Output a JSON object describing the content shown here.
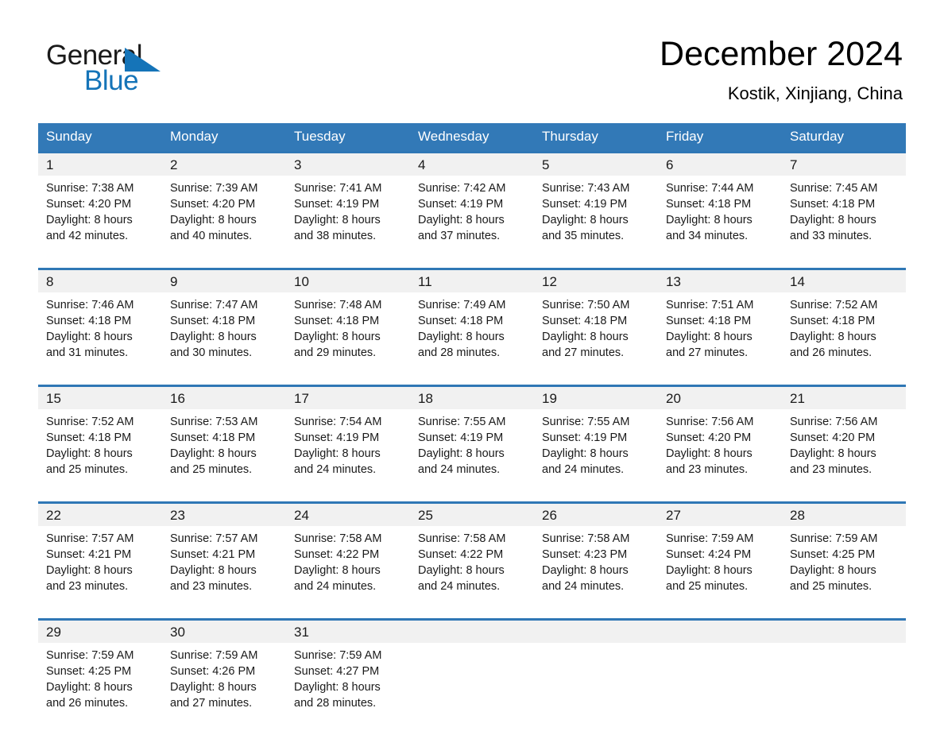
{
  "brand": {
    "name_part1": "General",
    "name_part2": "Blue",
    "accent_color": "#1574b8"
  },
  "header": {
    "title": "December 2024",
    "subtitle": "Kostik, Xinjiang, China"
  },
  "theme": {
    "header_row_bg": "#3279b7",
    "daynum_bg": "#f1f1f1",
    "separator": "#2f77b5"
  },
  "weekday_headers": [
    "Sunday",
    "Monday",
    "Tuesday",
    "Wednesday",
    "Thursday",
    "Friday",
    "Saturday"
  ],
  "weeks": [
    {
      "days": [
        {
          "date": "1",
          "sunrise": "Sunrise: 7:38 AM",
          "sunset": "Sunset: 4:20 PM",
          "daylight_1": "Daylight: 8 hours",
          "daylight_2": "and 42 minutes."
        },
        {
          "date": "2",
          "sunrise": "Sunrise: 7:39 AM",
          "sunset": "Sunset: 4:20 PM",
          "daylight_1": "Daylight: 8 hours",
          "daylight_2": "and 40 minutes."
        },
        {
          "date": "3",
          "sunrise": "Sunrise: 7:41 AM",
          "sunset": "Sunset: 4:19 PM",
          "daylight_1": "Daylight: 8 hours",
          "daylight_2": "and 38 minutes."
        },
        {
          "date": "4",
          "sunrise": "Sunrise: 7:42 AM",
          "sunset": "Sunset: 4:19 PM",
          "daylight_1": "Daylight: 8 hours",
          "daylight_2": "and 37 minutes."
        },
        {
          "date": "5",
          "sunrise": "Sunrise: 7:43 AM",
          "sunset": "Sunset: 4:19 PM",
          "daylight_1": "Daylight: 8 hours",
          "daylight_2": "and 35 minutes."
        },
        {
          "date": "6",
          "sunrise": "Sunrise: 7:44 AM",
          "sunset": "Sunset: 4:18 PM",
          "daylight_1": "Daylight: 8 hours",
          "daylight_2": "and 34 minutes."
        },
        {
          "date": "7",
          "sunrise": "Sunrise: 7:45 AM",
          "sunset": "Sunset: 4:18 PM",
          "daylight_1": "Daylight: 8 hours",
          "daylight_2": "and 33 minutes."
        }
      ]
    },
    {
      "days": [
        {
          "date": "8",
          "sunrise": "Sunrise: 7:46 AM",
          "sunset": "Sunset: 4:18 PM",
          "daylight_1": "Daylight: 8 hours",
          "daylight_2": "and 31 minutes."
        },
        {
          "date": "9",
          "sunrise": "Sunrise: 7:47 AM",
          "sunset": "Sunset: 4:18 PM",
          "daylight_1": "Daylight: 8 hours",
          "daylight_2": "and 30 minutes."
        },
        {
          "date": "10",
          "sunrise": "Sunrise: 7:48 AM",
          "sunset": "Sunset: 4:18 PM",
          "daylight_1": "Daylight: 8 hours",
          "daylight_2": "and 29 minutes."
        },
        {
          "date": "11",
          "sunrise": "Sunrise: 7:49 AM",
          "sunset": "Sunset: 4:18 PM",
          "daylight_1": "Daylight: 8 hours",
          "daylight_2": "and 28 minutes."
        },
        {
          "date": "12",
          "sunrise": "Sunrise: 7:50 AM",
          "sunset": "Sunset: 4:18 PM",
          "daylight_1": "Daylight: 8 hours",
          "daylight_2": "and 27 minutes."
        },
        {
          "date": "13",
          "sunrise": "Sunrise: 7:51 AM",
          "sunset": "Sunset: 4:18 PM",
          "daylight_1": "Daylight: 8 hours",
          "daylight_2": "and 27 minutes."
        },
        {
          "date": "14",
          "sunrise": "Sunrise: 7:52 AM",
          "sunset": "Sunset: 4:18 PM",
          "daylight_1": "Daylight: 8 hours",
          "daylight_2": "and 26 minutes."
        }
      ]
    },
    {
      "days": [
        {
          "date": "15",
          "sunrise": "Sunrise: 7:52 AM",
          "sunset": "Sunset: 4:18 PM",
          "daylight_1": "Daylight: 8 hours",
          "daylight_2": "and 25 minutes."
        },
        {
          "date": "16",
          "sunrise": "Sunrise: 7:53 AM",
          "sunset": "Sunset: 4:18 PM",
          "daylight_1": "Daylight: 8 hours",
          "daylight_2": "and 25 minutes."
        },
        {
          "date": "17",
          "sunrise": "Sunrise: 7:54 AM",
          "sunset": "Sunset: 4:19 PM",
          "daylight_1": "Daylight: 8 hours",
          "daylight_2": "and 24 minutes."
        },
        {
          "date": "18",
          "sunrise": "Sunrise: 7:55 AM",
          "sunset": "Sunset: 4:19 PM",
          "daylight_1": "Daylight: 8 hours",
          "daylight_2": "and 24 minutes."
        },
        {
          "date": "19",
          "sunrise": "Sunrise: 7:55 AM",
          "sunset": "Sunset: 4:19 PM",
          "daylight_1": "Daylight: 8 hours",
          "daylight_2": "and 24 minutes."
        },
        {
          "date": "20",
          "sunrise": "Sunrise: 7:56 AM",
          "sunset": "Sunset: 4:20 PM",
          "daylight_1": "Daylight: 8 hours",
          "daylight_2": "and 23 minutes."
        },
        {
          "date": "21",
          "sunrise": "Sunrise: 7:56 AM",
          "sunset": "Sunset: 4:20 PM",
          "daylight_1": "Daylight: 8 hours",
          "daylight_2": "and 23 minutes."
        }
      ]
    },
    {
      "days": [
        {
          "date": "22",
          "sunrise": "Sunrise: 7:57 AM",
          "sunset": "Sunset: 4:21 PM",
          "daylight_1": "Daylight: 8 hours",
          "daylight_2": "and 23 minutes."
        },
        {
          "date": "23",
          "sunrise": "Sunrise: 7:57 AM",
          "sunset": "Sunset: 4:21 PM",
          "daylight_1": "Daylight: 8 hours",
          "daylight_2": "and 23 minutes."
        },
        {
          "date": "24",
          "sunrise": "Sunrise: 7:58 AM",
          "sunset": "Sunset: 4:22 PM",
          "daylight_1": "Daylight: 8 hours",
          "daylight_2": "and 24 minutes."
        },
        {
          "date": "25",
          "sunrise": "Sunrise: 7:58 AM",
          "sunset": "Sunset: 4:22 PM",
          "daylight_1": "Daylight: 8 hours",
          "daylight_2": "and 24 minutes."
        },
        {
          "date": "26",
          "sunrise": "Sunrise: 7:58 AM",
          "sunset": "Sunset: 4:23 PM",
          "daylight_1": "Daylight: 8 hours",
          "daylight_2": "and 24 minutes."
        },
        {
          "date": "27",
          "sunrise": "Sunrise: 7:59 AM",
          "sunset": "Sunset: 4:24 PM",
          "daylight_1": "Daylight: 8 hours",
          "daylight_2": "and 25 minutes."
        },
        {
          "date": "28",
          "sunrise": "Sunrise: 7:59 AM",
          "sunset": "Sunset: 4:25 PM",
          "daylight_1": "Daylight: 8 hours",
          "daylight_2": "and 25 minutes."
        }
      ]
    },
    {
      "days": [
        {
          "date": "29",
          "sunrise": "Sunrise: 7:59 AM",
          "sunset": "Sunset: 4:25 PM",
          "daylight_1": "Daylight: 8 hours",
          "daylight_2": "and 26 minutes."
        },
        {
          "date": "30",
          "sunrise": "Sunrise: 7:59 AM",
          "sunset": "Sunset: 4:26 PM",
          "daylight_1": "Daylight: 8 hours",
          "daylight_2": "and 27 minutes."
        },
        {
          "date": "31",
          "sunrise": "Sunrise: 7:59 AM",
          "sunset": "Sunset: 4:27 PM",
          "daylight_1": "Daylight: 8 hours",
          "daylight_2": "and 28 minutes."
        },
        {
          "date": "",
          "sunrise": "",
          "sunset": "",
          "daylight_1": "",
          "daylight_2": ""
        },
        {
          "date": "",
          "sunrise": "",
          "sunset": "",
          "daylight_1": "",
          "daylight_2": ""
        },
        {
          "date": "",
          "sunrise": "",
          "sunset": "",
          "daylight_1": "",
          "daylight_2": ""
        },
        {
          "date": "",
          "sunrise": "",
          "sunset": "",
          "daylight_1": "",
          "daylight_2": ""
        }
      ]
    }
  ]
}
